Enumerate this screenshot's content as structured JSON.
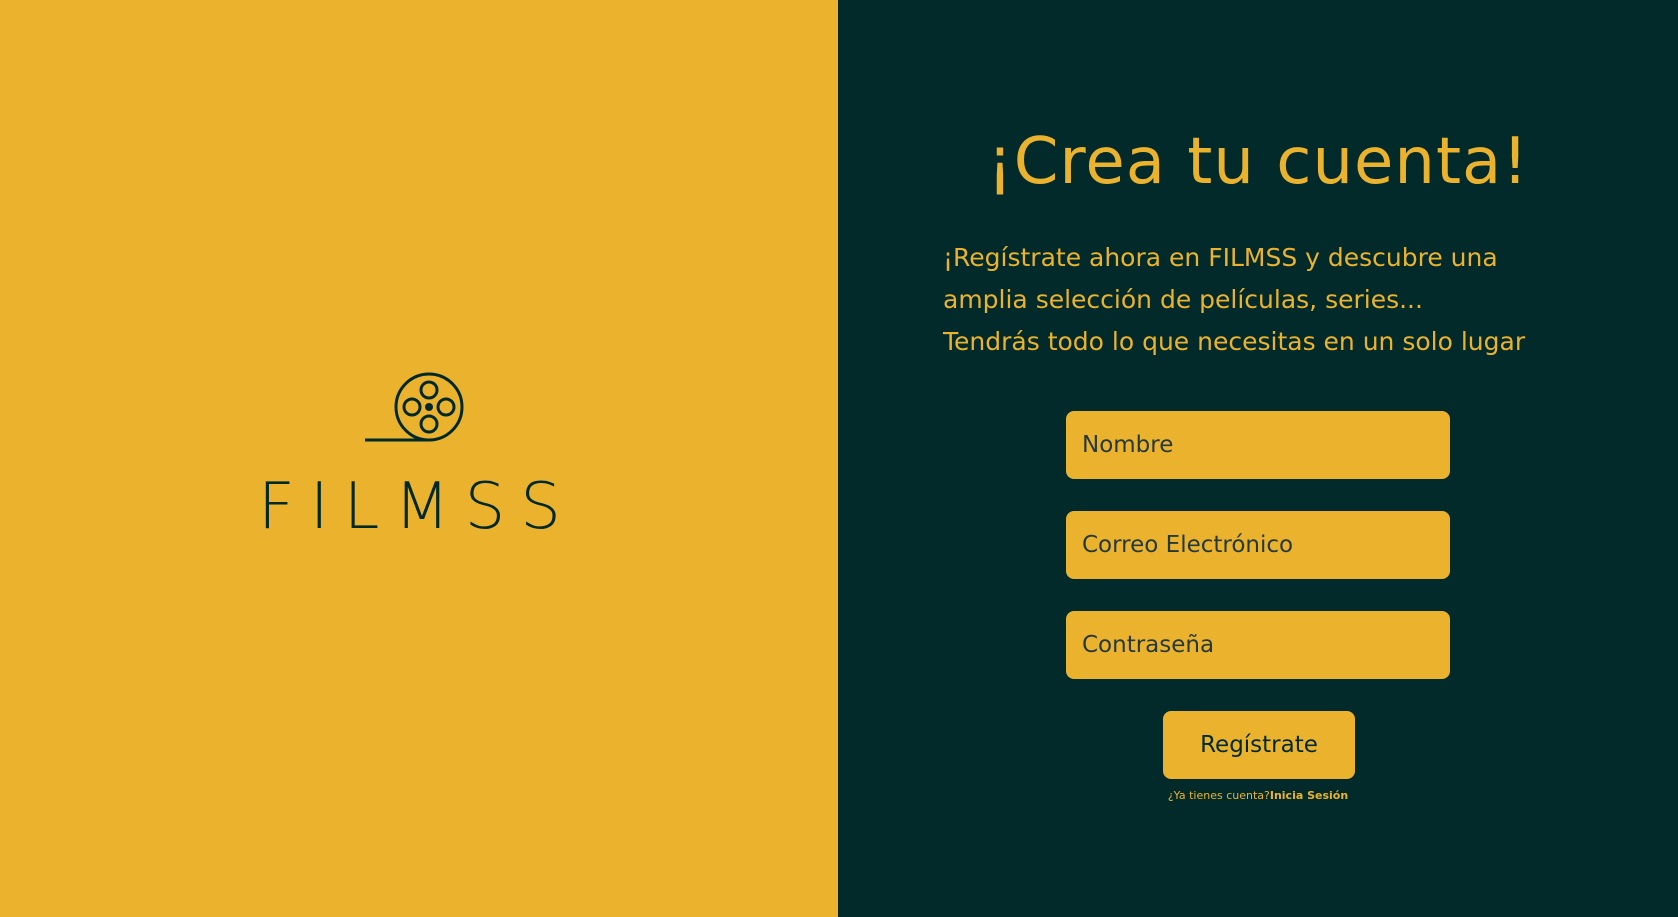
{
  "brand": {
    "name": "FILMSS",
    "logo_icon": "film-reel-icon",
    "colors": {
      "primary": "#ebb32d",
      "dark": "#022a2b"
    }
  },
  "signup": {
    "title": "¡Crea tu cuenta!",
    "intro_lines": [
      "¡Regístrate ahora en FILMSS y descubre una",
      "amplia selección de películas, series...",
      "Tendrás todo lo que necesitas en un solo lugar"
    ],
    "fields": {
      "name_placeholder": "Nombre",
      "email_placeholder": "Correo Electrónico",
      "password_placeholder": "Contraseña"
    },
    "submit_label": "Regístrate",
    "login_prompt": "¿Ya tienes cuenta?",
    "login_link": "Inicia Sesión"
  }
}
